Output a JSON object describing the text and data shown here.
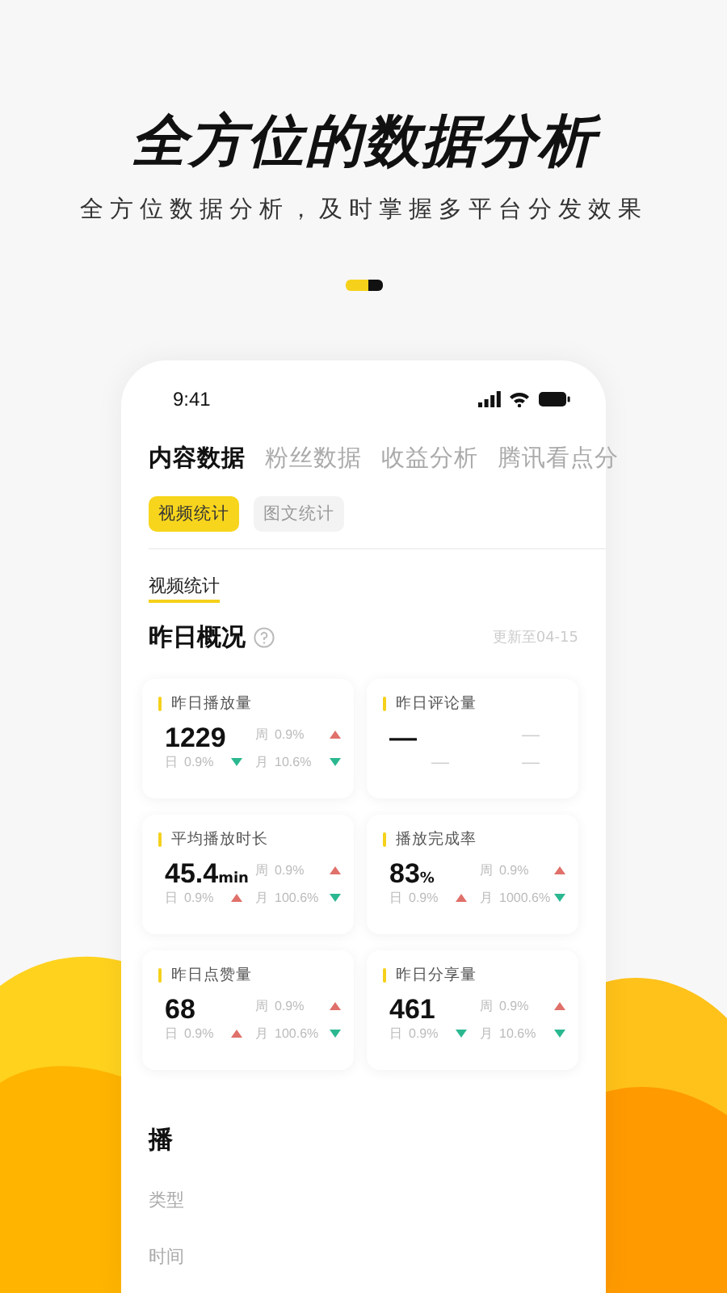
{
  "headline": "全方位的数据分析",
  "subtitle": "全方位数据分析，及时掌握多平台分发效果",
  "pager": [
    {
      "selected": true
    },
    {
      "selected": false
    }
  ],
  "phone": {
    "status_bar": {
      "time": "9:41"
    },
    "tabs": [
      {
        "label": "内容数据",
        "selected": true
      },
      {
        "label": "粉丝数据",
        "selected": false
      },
      {
        "label": "收益分析",
        "selected": false
      },
      {
        "label": "腾讯看点分",
        "selected": false
      }
    ],
    "chips": [
      {
        "label": "视频统计",
        "selected": true
      },
      {
        "label": "图文统计",
        "selected": false
      }
    ],
    "section_title": "视频统计",
    "overview": {
      "title": "昨日概况",
      "updated": "更新至04-15"
    },
    "metrics": [
      {
        "label": "昨日播放量",
        "value": "1229",
        "stats": [
          {
            "label": "周",
            "value": "0.9%",
            "kind": "up"
          },
          {
            "label": "日",
            "value": "0.9%",
            "kind": "down"
          },
          {
            "label": "月",
            "value": "10.6%",
            "kind": "down"
          }
        ]
      },
      {
        "label": "昨日评论量",
        "value": "—",
        "stats": [
          {
            "value": "—"
          },
          {
            "value": "—"
          },
          {
            "value": "—"
          }
        ]
      },
      {
        "label": "平均播放时长",
        "value": "45.4",
        "unit": "min",
        "stats": [
          {
            "label": "周",
            "value": "0.9%",
            "kind": "up"
          },
          {
            "label": "日",
            "value": "0.9%",
            "kind": "up"
          },
          {
            "label": "月",
            "value": "100.6%",
            "kind": "down"
          }
        ]
      },
      {
        "label": "播放完成率",
        "value": "83",
        "unit": "%",
        "stats": [
          {
            "label": "周",
            "value": "0.9%",
            "kind": "up"
          },
          {
            "label": "日",
            "value": "0.9%",
            "kind": "up"
          },
          {
            "label": "月",
            "value": "1000.6%",
            "kind": "down"
          }
        ]
      },
      {
        "label": "昨日点赞量",
        "value": "68",
        "stats": [
          {
            "label": "周",
            "value": "0.9%",
            "kind": "up"
          },
          {
            "label": "日",
            "value": "0.9%",
            "kind": "up"
          },
          {
            "label": "月",
            "value": "100.6%",
            "kind": "down"
          }
        ]
      },
      {
        "label": "昨日分享量",
        "value": "461",
        "stats": [
          {
            "label": "周",
            "value": "0.9%",
            "kind": "up"
          },
          {
            "label": "日",
            "value": "0.9%",
            "kind": "down"
          },
          {
            "label": "月",
            "value": "10.6%",
            "kind": "down"
          }
        ]
      }
    ],
    "playback": {
      "title": "播",
      "rows": [
        "类型",
        "时间"
      ]
    }
  }
}
